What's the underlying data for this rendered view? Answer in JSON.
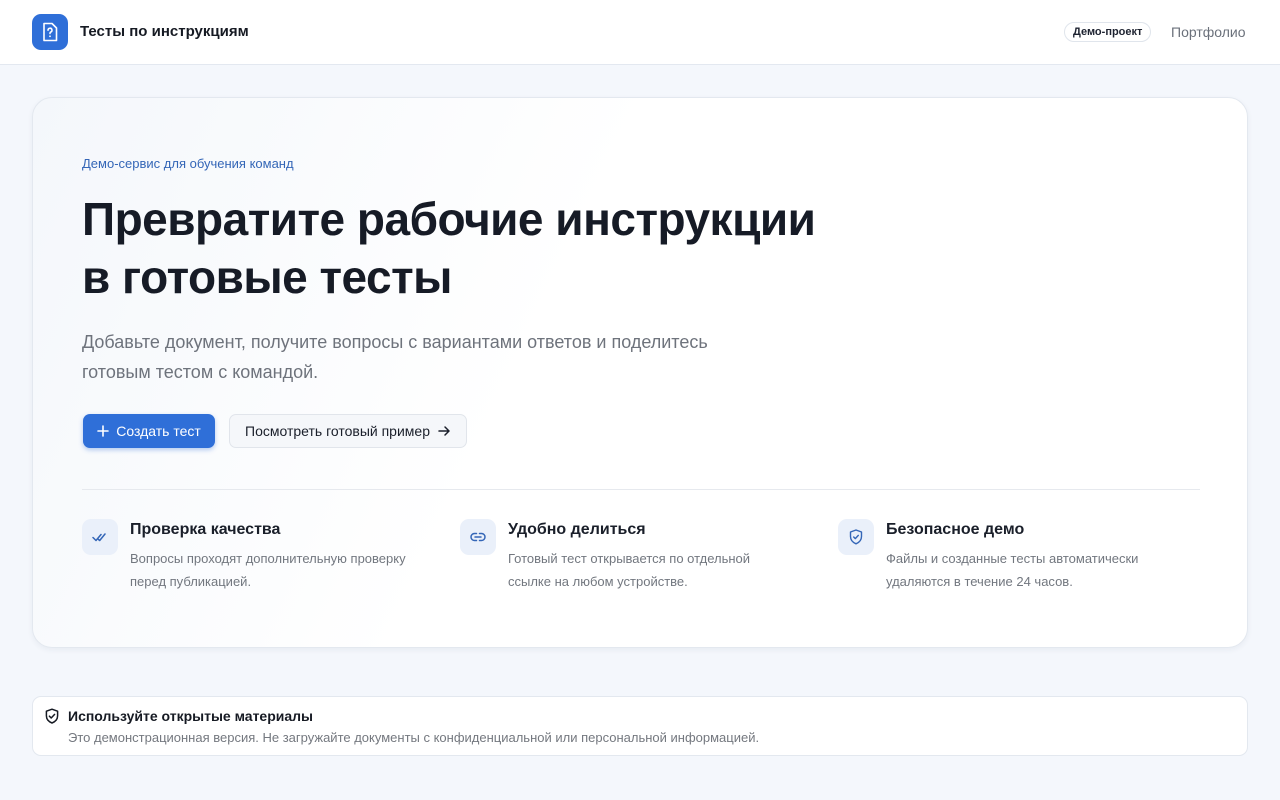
{
  "header": {
    "app_title": "Тесты по инструкциям",
    "logo_icon": "document-question-icon",
    "demo_badge": "Демо-проект",
    "portfolio_link": "Портфолио"
  },
  "hero": {
    "eyebrow": "Демо-сервис для обучения команд",
    "headline_lines": [
      "Превратите рабочие инструкции",
      "в готовые тесты"
    ],
    "subtitle_lines": [
      "Добавьте документ, получите вопросы с вариантами ответов и поделитесь",
      "готовым тестом с командой."
    ],
    "primary_button": {
      "label": "Создать тест",
      "icon": "plus-icon"
    },
    "secondary_button": {
      "label": "Посмотреть готовый пример",
      "icon": "arrow-right-icon"
    }
  },
  "features": [
    {
      "icon": "double-check-icon",
      "title": "Проверка качества",
      "desc_lines": [
        "Вопросы проходят дополнительную проверку",
        "перед публикацией."
      ]
    },
    {
      "icon": "link-icon",
      "title": "Удобно делиться",
      "desc_lines": [
        "Готовый тест открывается по отдельной",
        "ссылке на любом устройстве."
      ]
    },
    {
      "icon": "shield-icon",
      "title": "Безопасное демо",
      "desc_lines": [
        "Файлы и созданные тесты автоматически",
        "удаляются в течение 24 часов."
      ]
    }
  ],
  "notice": {
    "icon": "shield-check-icon",
    "title": "Используйте открытые материалы",
    "text": "Это демонстрационная версия. Не загружайте документы с конфиденциальной или персональной информацией."
  },
  "colors": {
    "accent": "#2f6fd8",
    "eyebrow": "#3466b7",
    "page_background": "#f4f7fc",
    "icon_tile": "#eaf0fa"
  }
}
